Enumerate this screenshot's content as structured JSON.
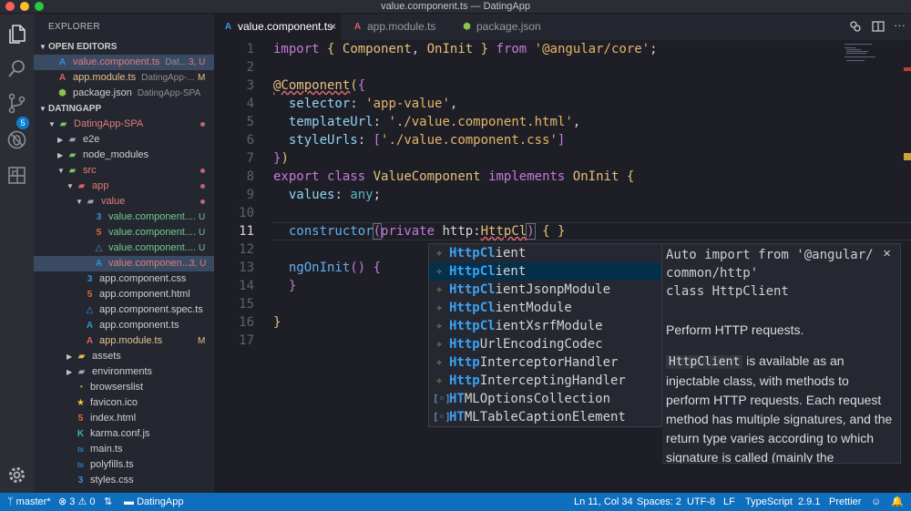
{
  "window": {
    "title": "value.component.ts — DatingApp"
  },
  "activity": {
    "icons": [
      "files-icon",
      "search-icon",
      "source-control-icon",
      "debug-icon",
      "extensions-icon",
      "settings-icon"
    ],
    "scm_badge": "5"
  },
  "sidebar": {
    "title": "EXPLORER",
    "open_editors_label": "OPEN EDITORS",
    "datingapp_label": "DATINGAPP",
    "open_editors": [
      {
        "name": "value.component.ts",
        "sub": "Dat...",
        "status": "3, U"
      },
      {
        "name": "app.module.ts",
        "sub": "DatingApp-...",
        "status": "M"
      },
      {
        "name": "package.json",
        "sub": "DatingApp-SPA",
        "status": ""
      }
    ],
    "tree": [
      {
        "name": "DatingApp-SPA",
        "status": ""
      },
      {
        "name": "e2e",
        "status": ""
      },
      {
        "name": "node_modules",
        "status": ""
      },
      {
        "name": "src",
        "status": ""
      },
      {
        "name": "app",
        "status": ""
      },
      {
        "name": "value",
        "status": ""
      },
      {
        "name": "value.component....",
        "status": "U"
      },
      {
        "name": "value.component....",
        "status": "U"
      },
      {
        "name": "value.component....",
        "status": "U"
      },
      {
        "name": "value.componen...",
        "status": "3, U"
      },
      {
        "name": "app.component.css",
        "status": ""
      },
      {
        "name": "app.component.html",
        "status": ""
      },
      {
        "name": "app.component.spec.ts",
        "status": ""
      },
      {
        "name": "app.component.ts",
        "status": ""
      },
      {
        "name": "app.module.ts",
        "status": "M"
      },
      {
        "name": "assets",
        "status": ""
      },
      {
        "name": "environments",
        "status": ""
      },
      {
        "name": "browserslist",
        "status": ""
      },
      {
        "name": "favicon.ico",
        "status": ""
      },
      {
        "name": "index.html",
        "status": ""
      },
      {
        "name": "karma.conf.js",
        "status": ""
      },
      {
        "name": "main.ts",
        "status": ""
      },
      {
        "name": "polyfills.ts",
        "status": ""
      },
      {
        "name": "styles.css",
        "status": ""
      }
    ]
  },
  "tabs": [
    {
      "label": "value.component.ts",
      "close": "×"
    },
    {
      "label": "app.module.ts"
    },
    {
      "label": "package.json"
    }
  ],
  "editor": {
    "line_numbers": [
      "1",
      "2",
      "3",
      "4",
      "5",
      "6",
      "7",
      "8",
      "9",
      "10",
      "11",
      "12",
      "13",
      "14",
      "15",
      "16",
      "17"
    ],
    "current_line": "11"
  },
  "suggest": {
    "items": [
      {
        "pre": "",
        "hl": "HttpCl",
        "post": "ient",
        "kind": "class"
      },
      {
        "pre": "",
        "hl": "HttpCl",
        "post": "ient",
        "kind": "class"
      },
      {
        "pre": "",
        "hl": "HttpCl",
        "post": "ientJsonpModule",
        "kind": "class"
      },
      {
        "pre": "",
        "hl": "HttpCl",
        "post": "ientModule",
        "kind": "class"
      },
      {
        "pre": "",
        "hl": "HttpCl",
        "post": "ientXsrfModule",
        "kind": "class"
      },
      {
        "pre": "",
        "hl": "Http",
        "post": "UrlEncodingCodec",
        "kind": "class"
      },
      {
        "pre": "",
        "hl": "Http",
        "post": "InterceptorHandler",
        "kind": "class"
      },
      {
        "pre": "",
        "hl": "Http",
        "post": "InterceptingHandler",
        "kind": "class"
      },
      {
        "pre": "",
        "hl": "HT",
        "post": "MLOptionsCollection",
        "kind": "var"
      },
      {
        "pre": "",
        "hl": "HT",
        "post": "MLTableCaptionElement",
        "kind": "var"
      }
    ]
  },
  "docs": {
    "signature": "Auto import from '@angular/common/http'\nclass HttpClient",
    "close": "×",
    "p1": "Perform HTTP requests.",
    "p2_code": "HttpClient",
    "p2_text": " is available as an injectable class, with methods to perform HTTP requests. Each request method has multiple signatures, and the return type varies according to which signature is called (mainly the"
  },
  "status": {
    "branch": "master*",
    "errors": "3",
    "warnings": "0",
    "folder": "DatingApp",
    "position": "Ln 11, Col 34",
    "spaces": "Spaces: 2",
    "encoding": "UTF-8",
    "eol": "LF",
    "language": "TypeScript",
    "version": "2.9.1",
    "formatter": "Prettier"
  }
}
